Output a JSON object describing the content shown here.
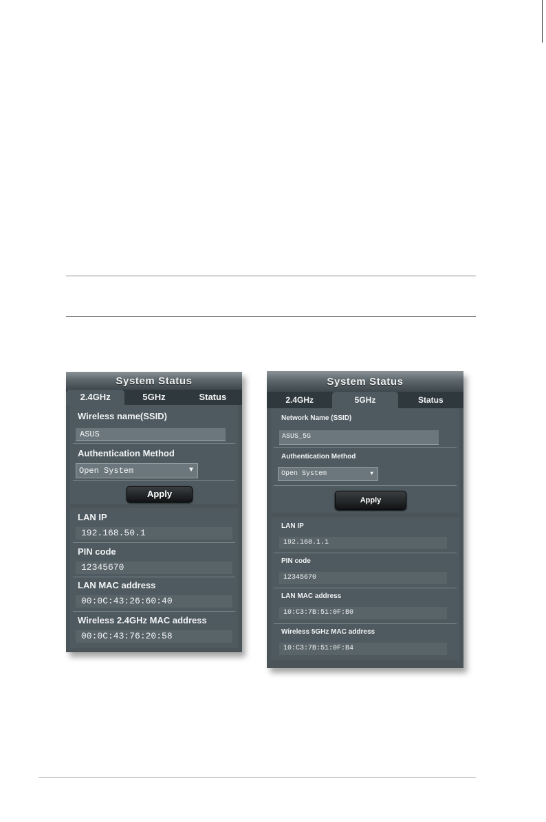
{
  "left": {
    "title": "System Status",
    "tabs": [
      "2.4GHz",
      "5GHz",
      "Status"
    ],
    "ssid_label": "Wireless name(SSID)",
    "ssid_value": "ASUS",
    "auth_label": "Authentication Method",
    "auth_value": "Open System",
    "apply_label": "Apply",
    "lan_ip_label": "LAN IP",
    "lan_ip_value": "192.168.50.1",
    "pin_label": "PIN code",
    "pin_value": "12345670",
    "lan_mac_label": "LAN MAC address",
    "lan_mac_value": "00:0C:43:26:60:40",
    "wl_mac_label": "Wireless 2.4GHz MAC address",
    "wl_mac_value": "00:0C:43:76:20:58"
  },
  "right": {
    "title": "System Status",
    "tabs": [
      "2.4GHz",
      "5GHz",
      "Status"
    ],
    "ssid_label": "Network Name (SSID)",
    "ssid_value": "ASUS_5G",
    "auth_label": "Authentication Method",
    "auth_value": "Open System",
    "apply_label": "Apply",
    "lan_ip_label": "LAN IP",
    "lan_ip_value": "192.168.1.1",
    "pin_label": "PIN code",
    "pin_value": "12345670",
    "lan_mac_label": "LAN MAC address",
    "lan_mac_value": "10:C3:7B:51:0F:B0",
    "wl_mac_label": "Wireless 5GHz MAC address",
    "wl_mac_value": "10:C3:7B:51:0F:B4"
  },
  "icons": {
    "dropdown": "chevron-down-icon"
  },
  "colors": {
    "panel": "#4a5459",
    "title_bar": "#5d676c",
    "tab_strip": "#2f383c",
    "button": "#1c1f20"
  }
}
